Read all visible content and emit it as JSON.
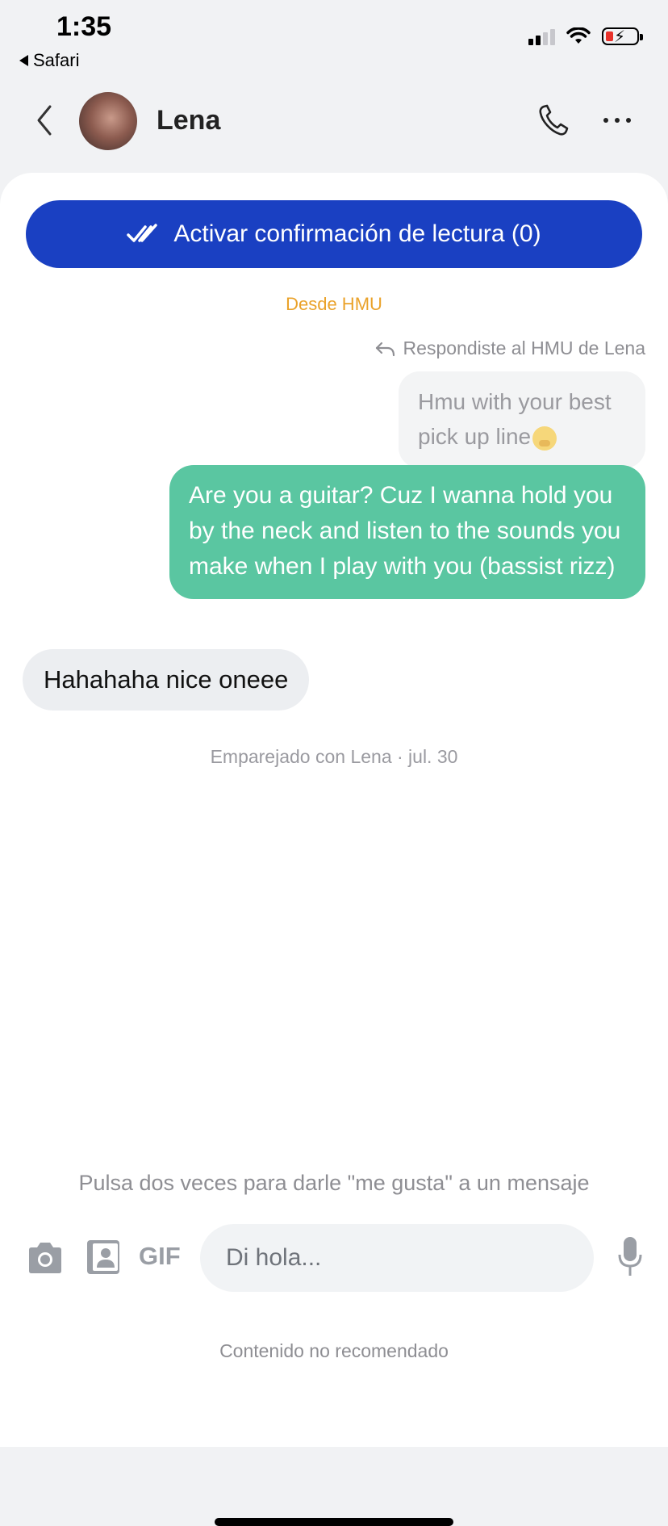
{
  "status_bar": {
    "time": "1:35",
    "back_app": "Safari"
  },
  "header": {
    "contact_name": "Lena"
  },
  "read_banner": {
    "label": "Activar confirmación de lectura (0)"
  },
  "conversation": {
    "source_label": "Desde HMU",
    "replied_note": "Respondiste al HMU de Lena",
    "quoted_message": "Hmu with your best pick up line",
    "sent_message": "Are you a guitar? Cuz I wanna hold you by the neck and listen to the sounds you make when I play with you (bassist rizz)",
    "received_message": "Hahahaha nice oneee",
    "matched_note": "Emparejado con Lena · jul. 30"
  },
  "composer": {
    "hint": "Pulsa dos veces para darle \"me gusta\" a un mensaje",
    "gif_label": "GIF",
    "placeholder": "Di hola..."
  },
  "footer": {
    "not_recommended": "Contenido no recomendado"
  },
  "colors": {
    "accent_blue": "#1a40c2",
    "sent_bubble": "#5ac6a1",
    "hmu_orange": "#eaa22a"
  },
  "icons": [
    "back-arrow-icon",
    "phone-icon",
    "more-dots-icon",
    "double-check-icon",
    "reply-arrow-icon",
    "camera-icon",
    "contact-card-icon",
    "microphone-icon",
    "signal-icon",
    "wifi-icon",
    "battery-icon"
  ]
}
